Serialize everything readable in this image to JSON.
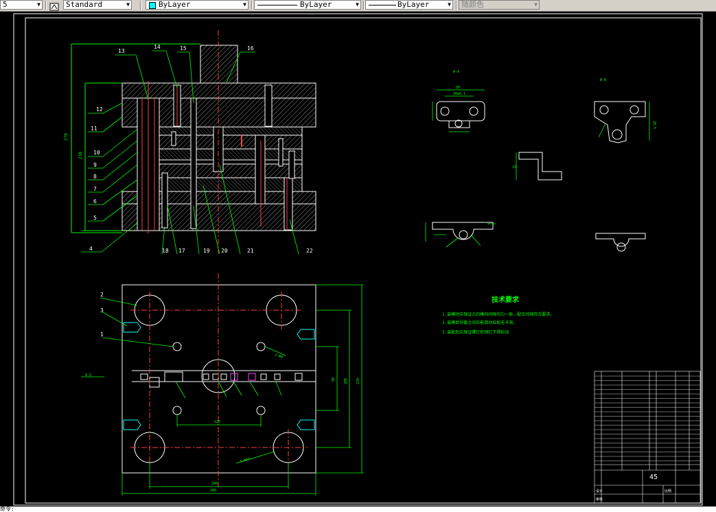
{
  "toolbar": {
    "style_combo_left": "5",
    "text_style": "Standard",
    "layer": "ByLayer",
    "linetype": "ByLayer",
    "lineweight": "ByLayer",
    "plot_style": "随颜色"
  },
  "drawing": {
    "part_numbers": [
      "13",
      "14",
      "15",
      "16",
      "12",
      "11",
      "10",
      "9",
      "8",
      "7",
      "6",
      "5",
      "4",
      "18",
      "17",
      "19",
      "20",
      "21",
      "22",
      "2",
      "3",
      "1"
    ],
    "tech_requirements": {
      "title": "技术要求",
      "items": [
        "1.装模时应保证凸凹模间间隙均匀一致，配合间隙符合要求。",
        "2.装模后导套之间应能滑动自如无卡滞。",
        "3.装配后应保证螺钉和销钉不得松动"
      ]
    },
    "title_block": {
      "material": "45",
      "label_designer": "设计",
      "label_check": "审核",
      "label_scale": "比例"
    }
  },
  "command_line": "命令:"
}
